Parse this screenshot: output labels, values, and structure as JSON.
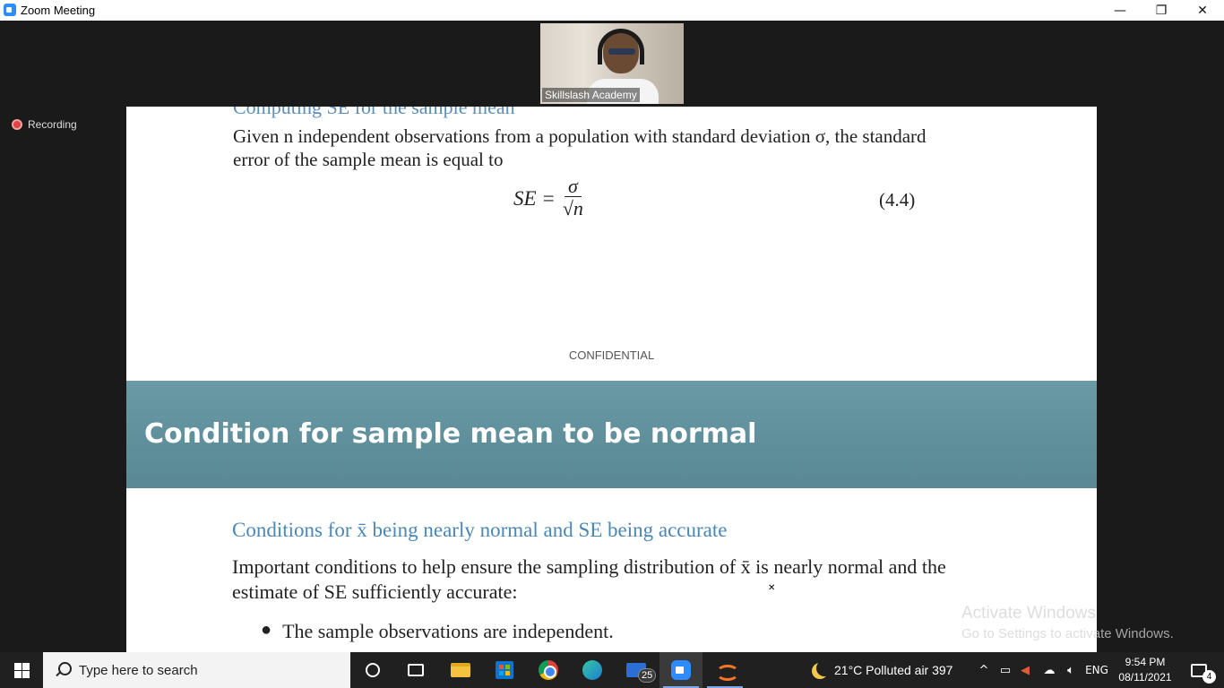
{
  "window": {
    "title": "Zoom Meeting",
    "minimize": "—",
    "restore": "❐",
    "close": "✕"
  },
  "video": {
    "participant_name": "Skillslash Academy"
  },
  "recording": {
    "label": "Recording"
  },
  "slide": {
    "cutoff_heading": "Computing SE for the sample mean",
    "given_text": "Given n independent observations from a population with standard deviation σ, the standard error of the sample mean is equal to",
    "formula_lhs": "SE =",
    "formula_num": "σ",
    "formula_den": "√n",
    "equation_number": "(4.4)",
    "confidential": "CONFIDENTIAL",
    "banner_title": "Condition for sample mean to be normal",
    "conditions_heading": "Conditions for x̄ being nearly normal and SE being accurate",
    "important_text": "Important conditions to help ensure the sampling distribution of x̄ is nearly normal and the estimate of SE sufficiently accurate:",
    "bullet_1": "The sample observations are independent."
  },
  "watermark": {
    "line1": "Activate Windows",
    "line2": "Go to Settings to activate Windows."
  },
  "taskbar": {
    "search_placeholder": "Type here to search",
    "mail_badge": "25",
    "weather": "21°C  Polluted air 397",
    "tray_chevron": "^",
    "language": "ENG",
    "time": "9:54 PM",
    "date": "08/11/2021",
    "notification_count": "4"
  }
}
